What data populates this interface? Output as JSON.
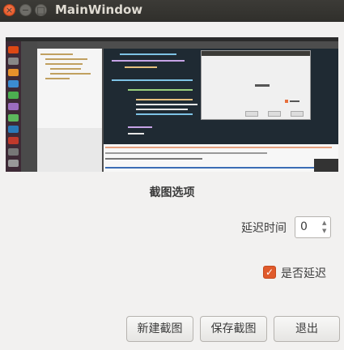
{
  "window": {
    "title": "MainWindow",
    "controls": {
      "close": "×",
      "minimize": "−",
      "maximize": "□"
    }
  },
  "preview": {
    "image": "screenshot-preview"
  },
  "options": {
    "section_title": "截图选项",
    "delay_label": "延迟时间",
    "delay_value": "0",
    "delay_enabled_checked": true,
    "delay_enabled_label": "是否延迟"
  },
  "actions": {
    "new_label": "新建截图",
    "save_label": "保存截图",
    "quit_label": "退出"
  },
  "colors": {
    "accent": "#e05a2b",
    "titlebar": "#3c3b37",
    "background": "#f2f1f0"
  }
}
